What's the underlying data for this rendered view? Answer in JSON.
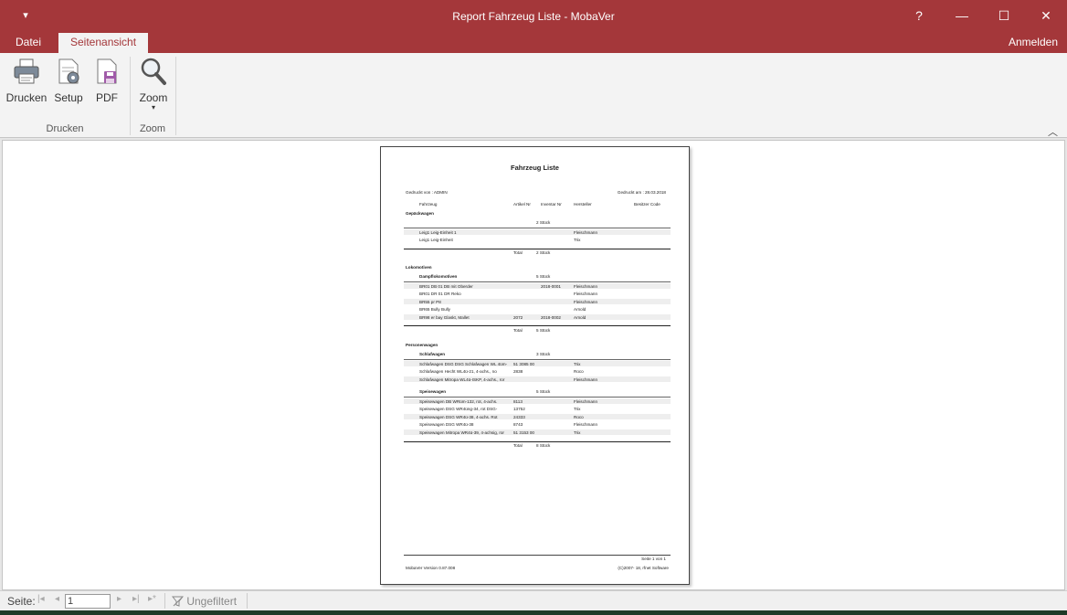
{
  "window": {
    "title": "Report Fahrzeug Liste - MobaVer",
    "quick_access": "▾",
    "help": "?",
    "minimize": "—",
    "maximize": "☐",
    "close": "✕"
  },
  "tabs": {
    "datei": "Datei",
    "seitenansicht": "Seitenansicht",
    "anmelden": "Anmelden"
  },
  "ribbon": {
    "drucken": "Drucken",
    "setup": "Setup",
    "pdf": "PDF",
    "zoom": "Zoom",
    "zoom_arrow": "▾",
    "group_drucken": "Drucken",
    "group_zoom": "Zoom",
    "collapse": "︿"
  },
  "report": {
    "title": "Fahrzeug Liste",
    "printed_by": "Gedruckt von : ADMIN",
    "printed_on": "Gedruckt am : 28.03.2018",
    "columns": [
      "Fahrzeug",
      "Artikel Nr",
      "Inventar Nr",
      "Hersteller",
      "Besitzer Code"
    ],
    "gepaeck": {
      "name": "Gepäckwagen",
      "count": "2 Stück",
      "rows": [
        {
          "name": "Leig1 Leig-Einheit 1",
          "art": "",
          "inv": "",
          "her": "Fleischmann"
        },
        {
          "name": "Leig1 Leig-Einheit",
          "art": "",
          "inv": "",
          "her": "Trix"
        }
      ],
      "total_label": "Total",
      "total": "2 Stück"
    },
    "lokomotiven": {
      "name": "Lokomotiven",
      "sub": "Dampflokomotiven",
      "count": "5 Stück",
      "rows": [
        {
          "name": "BR01 DB 01 DB mit Oberder",
          "art": "",
          "inv": "2018-0001",
          "her": "Fleischmann"
        },
        {
          "name": "BR01 DR 01 DR Reko",
          "art": "",
          "inv": "",
          "her": "Fleischmann"
        },
        {
          "name": "BR55 pr P8",
          "art": "",
          "inv": "",
          "her": "Fleischmann"
        },
        {
          "name": "BR65 Bully Bully",
          "art": "",
          "inv": "",
          "her": "Arnold"
        },
        {
          "name": "BR98 er bay Glaskt, Mallet",
          "art": "2072",
          "inv": "2018-0002",
          "her": "Arnold"
        }
      ],
      "total_label": "Total",
      "total": "5 Stück"
    },
    "personen": {
      "name": "Personenwagen",
      "sub1": "Schlafwagen",
      "count1": "3 Stück",
      "rows1": [
        {
          "name": "Schlafwagen DSG DSG Schlafwagen WL 4üm-",
          "art": "51 3085 00",
          "inv": "",
          "her": "Trix"
        },
        {
          "name": "Schlafwagen Hecht WL4ü-21, 4-achs., no",
          "art": "2838",
          "inv": "",
          "her": "Roco"
        },
        {
          "name": "Schlafwagen Mitropa WL4ü-ISKP, 4-achs., ror",
          "art": "",
          "inv": "",
          "her": "Fleischmann"
        }
      ],
      "sub2": "Speisewagen",
      "count2": "5 Stück",
      "rows2": [
        {
          "name": "Speisewagen DB WRüm-132, rot, 4-achs.",
          "art": "8113",
          "inv": "",
          "her": "Fleischmann"
        },
        {
          "name": "Speisewagen DSG WR4üng-34, rot DSG-",
          "art": "13752",
          "inv": "",
          "her": "Trix"
        },
        {
          "name": "Speisewagen DSG WR4ü-38, 4-achs. Rot",
          "art": "24333",
          "inv": "",
          "her": "Roco"
        },
        {
          "name": "Speisewagen DSG WR4ü-38",
          "art": "8743",
          "inv": "",
          "her": "Fleischmann"
        },
        {
          "name": "Speisewagen Mitropa WR4ü-39, 4-achsig, ror",
          "art": "51 3153 00",
          "inv": "",
          "her": "Trix"
        }
      ],
      "total_label": "Total",
      "total": "8 Stück"
    },
    "footer_page": "Seite 1 von 1",
    "footer_version": "MobaVer Version 0.87.008",
    "footer_copy": "(C)2007- 18, rfnet Software"
  },
  "statusbar": {
    "seite_label": "Seite:",
    "first": "|◂",
    "prev": "◂",
    "page_value": "1",
    "next": "▸",
    "last": "▸|",
    "new": "▸*",
    "filter": "Ungefiltert"
  }
}
